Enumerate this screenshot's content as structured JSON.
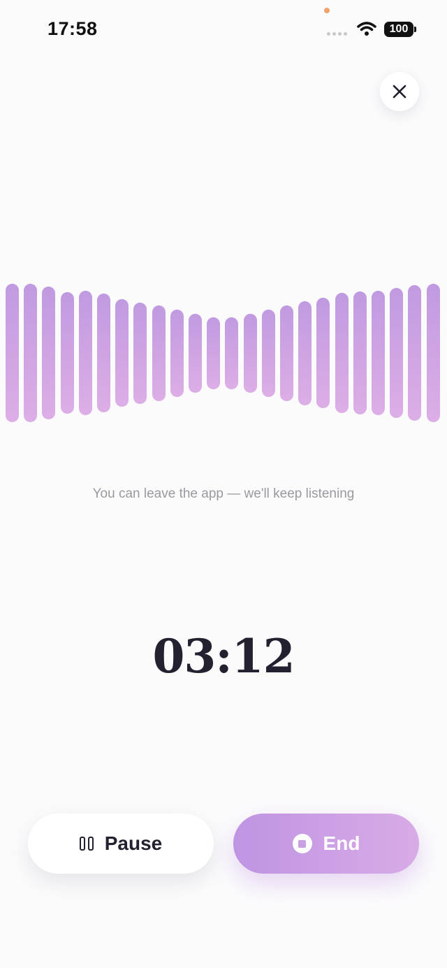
{
  "status_bar": {
    "time": "17:58",
    "battery": "100"
  },
  "icons": {
    "close": "close-icon",
    "pause": "pause-icon",
    "stop": "stop-icon",
    "wifi": "wifi-icon"
  },
  "colors": {
    "accent": "#c09ae0",
    "accent_light": "#ddaee6",
    "text": "#23212f",
    "hint": "#9a99a1"
  },
  "recorder": {
    "hint": "You can leave the app — we'll keep listening",
    "elapsed": "03:12",
    "waveform_levels": [
      1.0,
      1.0,
      0.96,
      0.88,
      0.9,
      0.86,
      0.78,
      0.73,
      0.69,
      0.63,
      0.57,
      0.52,
      0.52,
      0.57,
      0.63,
      0.69,
      0.75,
      0.8,
      0.87,
      0.89,
      0.9,
      0.94,
      0.98,
      1.0
    ]
  },
  "controls": {
    "pause_label": "Pause",
    "end_label": "End"
  }
}
